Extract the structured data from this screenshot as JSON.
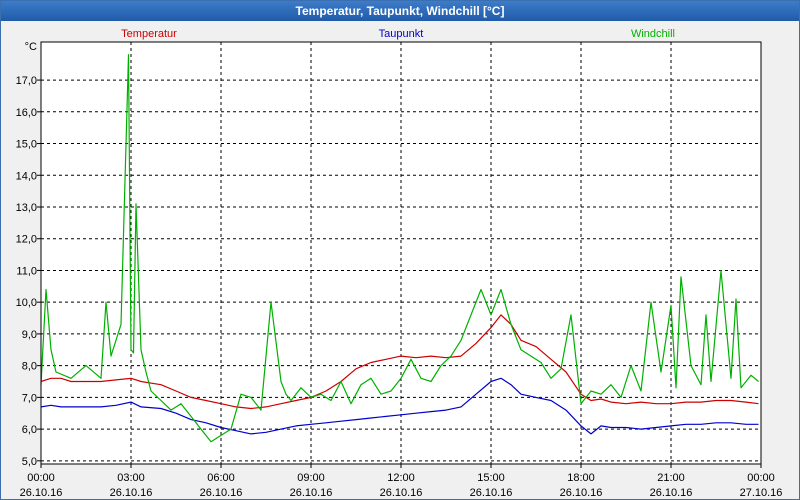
{
  "window": {
    "title": "Temperatur, Taupunkt, Windchill [°C]"
  },
  "colors": {
    "temperature": "#cc0000",
    "dewpoint": "#0000cc",
    "windchill": "#00b000",
    "grid": "#000000",
    "plot_background": "#ffffff"
  },
  "chart_data": {
    "type": "line",
    "title": "Temperatur, Taupunkt, Windchill [°C]",
    "ylabel": "°C",
    "ylim": [
      4.9,
      18.2
    ],
    "xlim": [
      "26.10.16 00:00",
      "27.10.16 00:00"
    ],
    "grid": true,
    "legend_placement": "top",
    "ytick_labels": [
      "5,0",
      "6,0",
      "7,0",
      "8,0",
      "9,0",
      "10,0",
      "11,0",
      "12,0",
      "13,0",
      "14,0",
      "15,0",
      "16,0",
      "17,0"
    ],
    "ytick_values": [
      5,
      6,
      7,
      8,
      9,
      10,
      11,
      12,
      13,
      14,
      15,
      16,
      17
    ],
    "xticks": [
      {
        "time": "00:00",
        "date": "26.10.16"
      },
      {
        "time": "03:00",
        "date": "26.10.16"
      },
      {
        "time": "06:00",
        "date": "26.10.16"
      },
      {
        "time": "09:00",
        "date": "26.10.16"
      },
      {
        "time": "12:00",
        "date": "26.10.16"
      },
      {
        "time": "15:00",
        "date": "26.10.16"
      },
      {
        "time": "18:00",
        "date": "26.10.16"
      },
      {
        "time": "21:00",
        "date": "26.10.16"
      },
      {
        "time": "00:00",
        "date": "27.10.16"
      }
    ],
    "series": [
      {
        "name": "Temperatur",
        "color": "#cc0000",
        "x": [
          "00:00",
          "00:20",
          "00:40",
          "01:00",
          "01:30",
          "02:00",
          "02:30",
          "03:00",
          "03:20",
          "04:00",
          "04:30",
          "05:00",
          "05:30",
          "06:00",
          "06:30",
          "07:00",
          "07:30",
          "08:00",
          "08:30",
          "09:00",
          "09:30",
          "10:00",
          "10:30",
          "11:00",
          "11:30",
          "12:00",
          "12:30",
          "13:00",
          "13:30",
          "14:00",
          "14:30",
          "15:00",
          "15:20",
          "15:40",
          "16:00",
          "16:30",
          "17:00",
          "17:30",
          "18:00",
          "18:20",
          "18:40",
          "19:00",
          "19:30",
          "20:00",
          "20:30",
          "21:00",
          "21:30",
          "22:00",
          "22:30",
          "23:00",
          "23:30",
          "23:55"
        ],
        "values": [
          7.5,
          7.6,
          7.6,
          7.5,
          7.5,
          7.5,
          7.55,
          7.6,
          7.5,
          7.4,
          7.2,
          7.0,
          6.9,
          6.8,
          6.7,
          6.65,
          6.7,
          6.8,
          6.9,
          7.0,
          7.2,
          7.5,
          7.9,
          8.1,
          8.2,
          8.3,
          8.25,
          8.3,
          8.25,
          8.3,
          8.7,
          9.2,
          9.6,
          9.3,
          8.8,
          8.6,
          8.2,
          7.8,
          7.1,
          6.9,
          6.95,
          6.85,
          6.8,
          6.85,
          6.8,
          6.8,
          6.85,
          6.85,
          6.9,
          6.9,
          6.85,
          6.8
        ]
      },
      {
        "name": "Taupunkt",
        "color": "#0000cc",
        "x": [
          "00:00",
          "00:20",
          "00:40",
          "01:00",
          "01:30",
          "02:00",
          "02:30",
          "03:00",
          "03:20",
          "04:00",
          "04:30",
          "05:00",
          "05:30",
          "06:00",
          "06:30",
          "07:00",
          "07:30",
          "08:00",
          "08:30",
          "09:00",
          "09:30",
          "10:00",
          "10:30",
          "11:00",
          "11:30",
          "12:00",
          "12:30",
          "13:00",
          "13:30",
          "14:00",
          "14:30",
          "15:00",
          "15:20",
          "15:40",
          "16:00",
          "16:30",
          "17:00",
          "17:30",
          "18:00",
          "18:20",
          "18:40",
          "19:00",
          "19:30",
          "20:00",
          "20:30",
          "21:00",
          "21:30",
          "22:00",
          "22:30",
          "23:00",
          "23:30",
          "23:55"
        ],
        "values": [
          6.7,
          6.75,
          6.7,
          6.7,
          6.7,
          6.7,
          6.75,
          6.85,
          6.7,
          6.65,
          6.5,
          6.3,
          6.2,
          6.05,
          5.95,
          5.85,
          5.9,
          6.0,
          6.1,
          6.15,
          6.2,
          6.25,
          6.3,
          6.35,
          6.4,
          6.45,
          6.5,
          6.55,
          6.6,
          6.7,
          7.1,
          7.5,
          7.6,
          7.4,
          7.1,
          7.0,
          6.9,
          6.6,
          6.1,
          5.85,
          6.1,
          6.05,
          6.05,
          6.0,
          6.05,
          6.1,
          6.15,
          6.15,
          6.2,
          6.2,
          6.15,
          6.15
        ]
      },
      {
        "name": "Windchill",
        "color": "#00b000",
        "x": [
          "00:00",
          "00:10",
          "00:20",
          "00:30",
          "01:00",
          "01:30",
          "02:00",
          "02:10",
          "02:20",
          "02:40",
          "02:55",
          "03:00",
          "03:05",
          "03:10",
          "03:20",
          "03:30",
          "03:40",
          "04:00",
          "04:20",
          "04:40",
          "05:00",
          "05:20",
          "05:40",
          "06:00",
          "06:20",
          "06:40",
          "07:00",
          "07:20",
          "07:40",
          "08:00",
          "08:10",
          "08:20",
          "08:40",
          "09:00",
          "09:20",
          "09:40",
          "10:00",
          "10:20",
          "10:40",
          "11:00",
          "11:20",
          "11:40",
          "12:00",
          "12:20",
          "12:40",
          "13:00",
          "13:20",
          "13:40",
          "14:00",
          "14:20",
          "14:40",
          "15:00",
          "15:20",
          "15:40",
          "16:00",
          "16:20",
          "16:40",
          "17:00",
          "17:20",
          "17:40",
          "18:00",
          "18:20",
          "18:40",
          "19:00",
          "19:20",
          "19:40",
          "20:00",
          "20:20",
          "20:40",
          "21:00",
          "21:10",
          "21:20",
          "21:40",
          "22:00",
          "22:10",
          "22:20",
          "22:40",
          "23:00",
          "23:10",
          "23:20",
          "23:40",
          "23:55"
        ],
        "values": [
          7.4,
          10.4,
          8.5,
          7.8,
          7.6,
          8.0,
          7.6,
          10.0,
          8.3,
          9.3,
          17.8,
          8.5,
          8.4,
          13.1,
          8.5,
          7.8,
          7.2,
          6.9,
          6.6,
          6.8,
          6.4,
          6.0,
          5.6,
          5.8,
          6.0,
          7.1,
          7.0,
          6.6,
          10.0,
          7.5,
          7.1,
          6.9,
          7.3,
          7.0,
          7.1,
          6.9,
          7.5,
          6.8,
          7.4,
          7.6,
          7.1,
          7.2,
          7.6,
          8.2,
          7.6,
          7.5,
          8.0,
          8.3,
          8.8,
          9.6,
          10.4,
          9.6,
          10.4,
          9.3,
          8.5,
          8.3,
          8.1,
          7.6,
          7.9,
          9.6,
          6.8,
          7.2,
          7.1,
          7.4,
          7.0,
          8.0,
          7.2,
          10.0,
          7.8,
          9.9,
          7.3,
          10.8,
          8.0,
          7.4,
          9.6,
          7.5,
          11.0,
          7.6,
          10.1,
          7.3,
          7.7,
          7.5
        ]
      }
    ]
  }
}
